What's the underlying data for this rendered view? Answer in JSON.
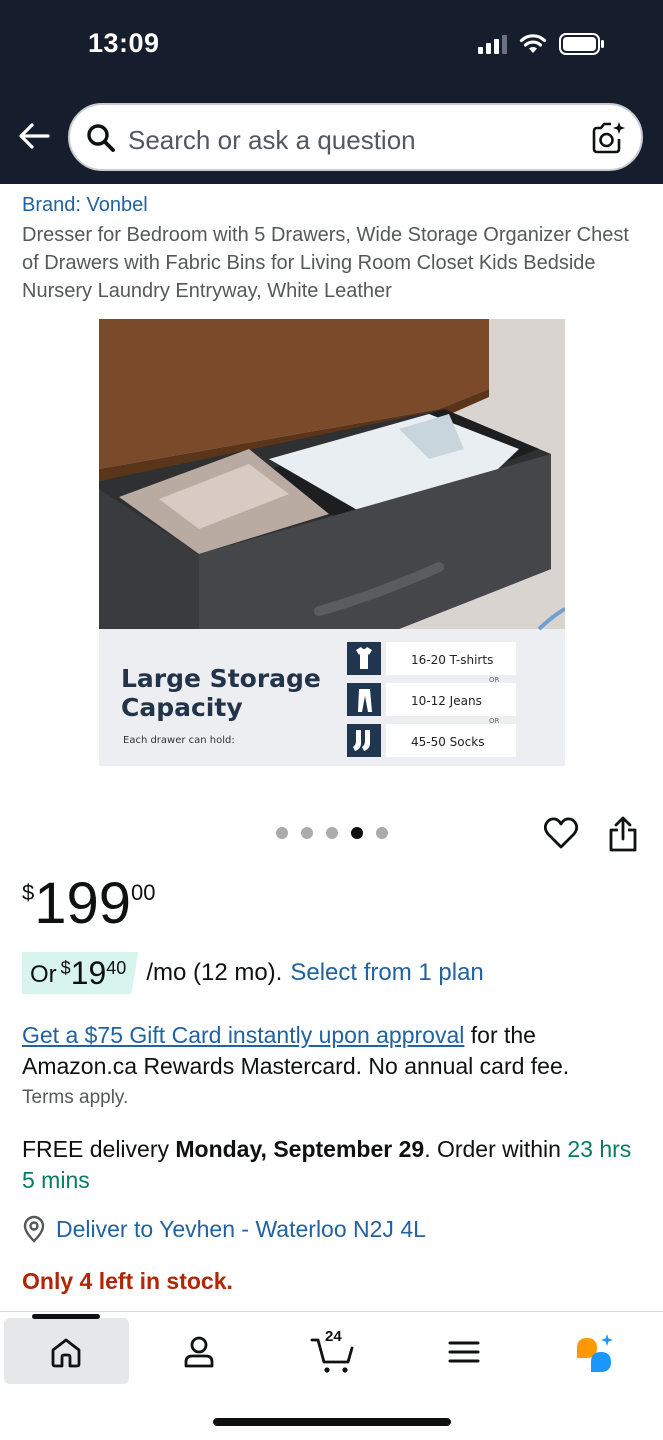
{
  "status_bar": {
    "time": "13:09"
  },
  "search": {
    "placeholder": "Search or ask a question"
  },
  "product": {
    "brand": "Brand: Vonbel",
    "title": "Dresser for Bedroom with 5 Drawers, Wide Storage Organizer Chest of Drawers with Fabric Bins for Living Room Closet Kids Bedside Nursery Laundry Entryway, White Leather",
    "image": {
      "headline_line1": "Large Storage",
      "headline_line2": "Capacity",
      "caption": "Each drawer can hold:",
      "items": [
        "16-20 T-shirts",
        "10-12 Jeans",
        "45-50 Socks"
      ],
      "or_label": "OR"
    }
  },
  "carousel": {
    "count": 5,
    "active_index": 3
  },
  "price": {
    "symbol": "$",
    "whole": "199",
    "fraction": "00"
  },
  "monthly": {
    "or": "Or",
    "symbol": "$",
    "whole": "19",
    "fraction": "40",
    "rest": "/mo (12 mo).",
    "link": "Select from 1 plan"
  },
  "gift": {
    "link": "Get a $75 Gift Card instantly upon approval",
    "text": " for the Amazon.ca Rewards Mastercard. No annual card fee.",
    "terms": "Terms apply."
  },
  "delivery": {
    "prefix": "FREE delivery ",
    "date": "Monday, September 29",
    "middle": ". Order within ",
    "countdown": "23 hrs 5 mins"
  },
  "deliver_to": "Deliver to Yevhen - Waterloo N2J 4L",
  "stock": "Only 4 left in stock.",
  "tabbar": {
    "cart_count": "24"
  },
  "colors": {
    "header_bg": "#161d2c",
    "link": "#2162a1",
    "stock_red": "#b12704",
    "countdown_green": "#067d62",
    "monthly_bg": "#d7f5ec"
  }
}
